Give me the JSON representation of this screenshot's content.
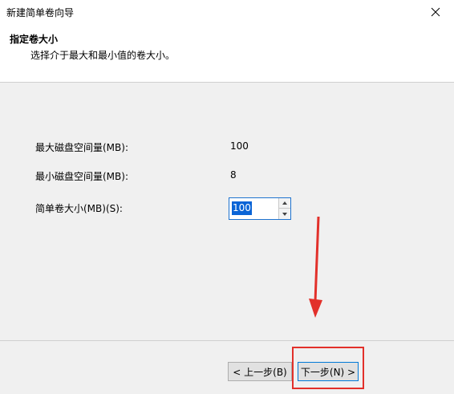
{
  "window": {
    "title": "新建简单卷向导"
  },
  "header": {
    "title": "指定卷大小",
    "subtitle": "选择介于最大和最小值的卷大小。"
  },
  "fields": {
    "max_label": "最大磁盘空间量(MB):",
    "max_value": "100",
    "min_label": "最小磁盘空间量(MB):",
    "min_value": "8",
    "size_label": "简单卷大小(MB)(S):",
    "size_value": "100"
  },
  "buttons": {
    "back_label": "< 上一步(B)",
    "next_label": "下一步(N) >"
  },
  "icons": {
    "close": "close-icon",
    "spin_up": "chevron-up-icon",
    "spin_down": "chevron-down-icon",
    "annotation_arrow": "arrow-down-icon"
  },
  "colors": {
    "accent": "#0078d7",
    "annotation": "#e2302a",
    "selection": "#0a64d6"
  }
}
